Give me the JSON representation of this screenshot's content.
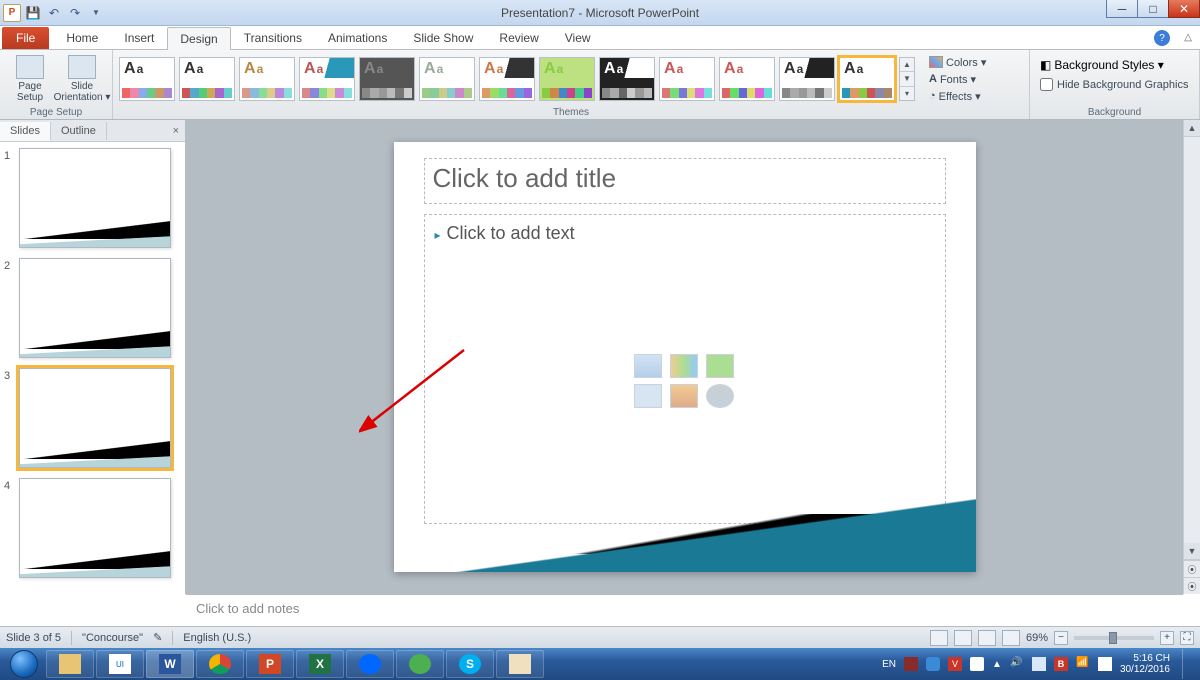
{
  "titlebar": {
    "title": "Presentation7 - Microsoft PowerPoint",
    "app_icon_letter": "P"
  },
  "win_controls": {
    "min": "─",
    "max": "□",
    "close": "✕"
  },
  "tabs": {
    "file": "File",
    "items": [
      "Home",
      "Insert",
      "Design",
      "Transitions",
      "Animations",
      "Slide Show",
      "Review",
      "View"
    ],
    "active_index": 2
  },
  "ribbon": {
    "page_setup": {
      "page_setup": "Page\nSetup",
      "orientation": "Slide\nOrientation ▾",
      "label": "Page Setup"
    },
    "themes_label": "Themes",
    "themes_more": [
      "▲",
      "▼",
      "▾"
    ],
    "variants": {
      "colors": "Colors ▾",
      "fonts": "Fonts ▾",
      "effects": "Effects ▾"
    },
    "background": {
      "styles": "Background Styles ▾",
      "hide": "Hide Background Graphics",
      "label": "Background"
    }
  },
  "panel": {
    "tab_slides": "Slides",
    "tab_outline": "Outline",
    "close": "×",
    "slide_numbers": [
      "1",
      "2",
      "3",
      "4"
    ],
    "selected": 2
  },
  "slide_content": {
    "title_placeholder": "Click to add title",
    "body_placeholder": "Click to add text",
    "bullet": "▸"
  },
  "notes": {
    "placeholder": "Click to add notes"
  },
  "statusbar": {
    "slide_pos": "Slide 3 of 5",
    "theme_name": "\"Concourse\"",
    "language": "English (U.S.)",
    "zoom_pct": "69%"
  },
  "taskbar": {
    "tray_lang": "EN",
    "clock_time": "5:16 CH",
    "clock_date": "30/12/2016"
  },
  "theme_thumbs": [
    {
      "aa_color": "#333",
      "bg": "#fff",
      "strip": [
        "#e66",
        "#e8a",
        "#8ae",
        "#6c8",
        "#c96",
        "#a8c"
      ]
    },
    {
      "aa_color": "#333",
      "bg": "#fff",
      "strip": [
        "#c55",
        "#5ac",
        "#5c7",
        "#ca5",
        "#a6c",
        "#6cc"
      ]
    },
    {
      "aa_color": "#b84",
      "bg": "#fff",
      "strip": [
        "#d98",
        "#8bd",
        "#8d9",
        "#dc8",
        "#b8d",
        "#8dd"
      ]
    },
    {
      "aa_color": "#b55",
      "bg": "#fff",
      "strip": [
        "#d88",
        "#88d",
        "#8d8",
        "#dd8",
        "#c8d",
        "#8dd"
      ],
      "half": "#2a98b8"
    },
    {
      "aa_color": "#888",
      "bg": "#555",
      "strip": [
        "#888",
        "#aaa",
        "#999",
        "#bbb",
        "#777",
        "#ccc"
      ]
    },
    {
      "aa_color": "#9a9",
      "bg": "#fff",
      "strip": [
        "#9c8",
        "#8c9",
        "#cc8",
        "#8cc",
        "#c8c",
        "#ac8"
      ]
    },
    {
      "aa_color": "#c74",
      "bg": "#fff",
      "strip": [
        "#d96",
        "#9d6",
        "#6d9",
        "#d69",
        "#69d",
        "#96d"
      ],
      "half": "#333"
    },
    {
      "aa_color": "#8c4",
      "bg": "#bde080",
      "strip": [
        "#8c4",
        "#c84",
        "#48c",
        "#c48",
        "#4c8",
        "#84c"
      ]
    },
    {
      "aa_color": "#fff",
      "bg": "#222",
      "strip": [
        "#888",
        "#aaa",
        "#666",
        "#ccc",
        "#999",
        "#bbb"
      ],
      "half": "#fff"
    },
    {
      "aa_color": "#c55",
      "bg": "#fff",
      "strip": [
        "#d77",
        "#7d7",
        "#77d",
        "#dd7",
        "#d7d",
        "#7dd"
      ]
    },
    {
      "aa_color": "#c55",
      "bg": "#fff",
      "strip": [
        "#d66",
        "#6d6",
        "#66d",
        "#dd6",
        "#d6d",
        "#6dd"
      ]
    },
    {
      "aa_color": "#333",
      "bg": "#fff",
      "strip": [
        "#888",
        "#aaa",
        "#999",
        "#bbb",
        "#777",
        "#ccc"
      ],
      "half": "#222"
    },
    {
      "aa_color": "#333",
      "bg": "#fff",
      "strip": [
        "#2a98b8",
        "#d96",
        "#8c4",
        "#c55",
        "#88a",
        "#a86"
      ],
      "sel": true
    }
  ]
}
